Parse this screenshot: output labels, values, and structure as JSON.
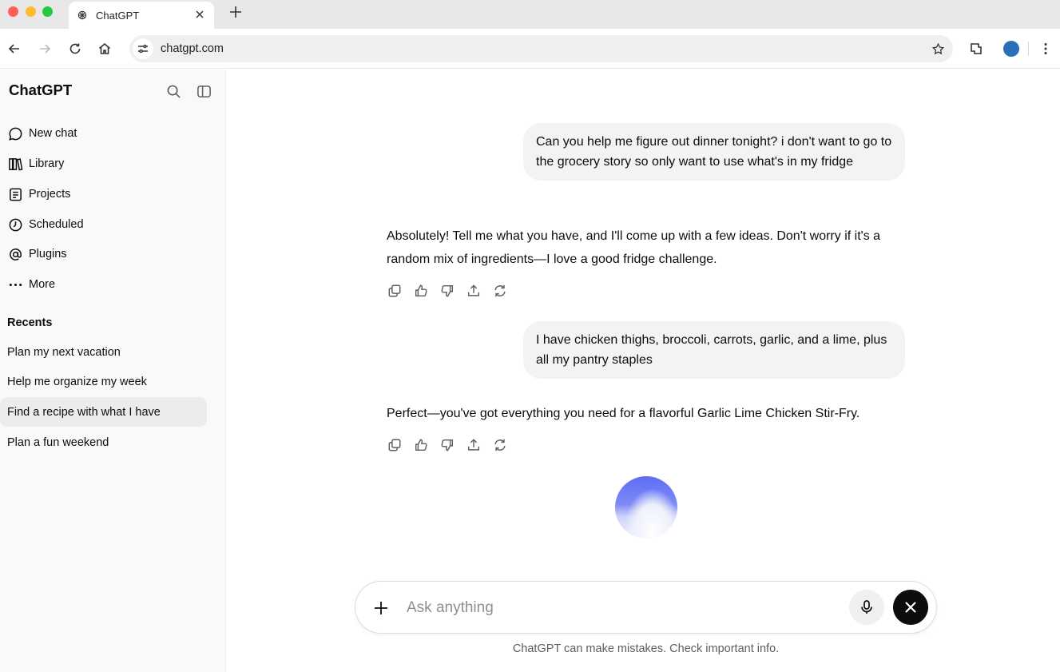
{
  "browser": {
    "tab_title": "ChatGPT",
    "url": "chatgpt.com",
    "profile_color": "#2a6fb8"
  },
  "sidebar": {
    "brand": "ChatGPT",
    "nav": [
      {
        "label": "New chat",
        "icon": "chat-bubble-icon"
      },
      {
        "label": "Library",
        "icon": "library-icon"
      },
      {
        "label": "Projects",
        "icon": "projects-icon"
      },
      {
        "label": "Scheduled",
        "icon": "clock-icon"
      },
      {
        "label": "Plugins",
        "icon": "at-sign-icon"
      },
      {
        "label": "More",
        "icon": "more-dots-icon"
      }
    ],
    "recents_title": "Recents",
    "recents": [
      {
        "label": "Plan my next vacation"
      },
      {
        "label": "Help me organize my week"
      },
      {
        "label": "Find a recipe with what I have",
        "active": true
      },
      {
        "label": "Plan a fun weekend"
      }
    ]
  },
  "conversation": [
    {
      "role": "user",
      "text": "Can you help me figure out dinner tonight? i don't want to go to the grocery story so only want to use what's in my fridge"
    },
    {
      "role": "assistant",
      "text": "Absolutely! Tell me what you have, and I'll come up with a few ideas. Don't worry if it's a random mix of ingredients—I love a good fridge challenge."
    },
    {
      "role": "user",
      "text": "I have chicken thighs, broccoli, carrots, garlic, and a lime, plus all my pantry staples"
    },
    {
      "role": "assistant",
      "text": "Perfect—you've got everything you need for a flavorful Garlic Lime Chicken Stir-Fry."
    }
  ],
  "composer": {
    "placeholder": "Ask anything",
    "disclaimer": "ChatGPT can make mistakes. Check important info."
  }
}
